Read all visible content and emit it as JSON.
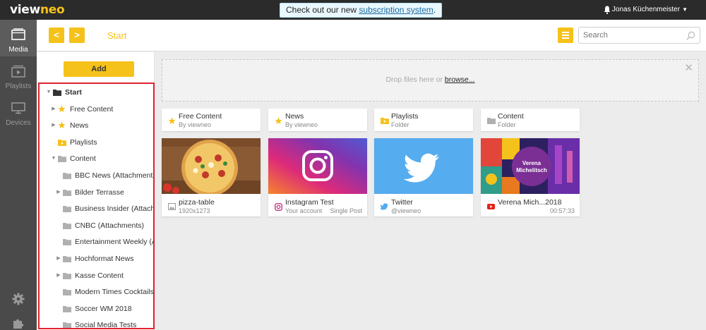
{
  "app": {
    "logo_main": "view",
    "logo_accent": "neo",
    "announcement_prefix": "Check out our new ",
    "announcement_link": "subscription system",
    "announcement_suffix": ".",
    "user_name": "Jonas Küchenmeister"
  },
  "colors": {
    "accent": "#f5c21b",
    "highlight": "#e0232f",
    "nav_bg": "#4a4a4a",
    "topbar_bg": "#2b2b2b"
  },
  "leftnav": [
    {
      "label": "Media",
      "icon": "media-icon",
      "active": true
    },
    {
      "label": "Playlists",
      "icon": "playlist-icon",
      "active": false
    },
    {
      "label": "Devices",
      "icon": "devices-icon",
      "active": false
    }
  ],
  "header": {
    "breadcrumb": "Start",
    "search_placeholder": "Search"
  },
  "sidebar": {
    "add_label": "Add",
    "tree": [
      {
        "label": "Start",
        "icon": "folder-dark-icon",
        "level": 0,
        "expander": "expanded"
      },
      {
        "label": "Free Content",
        "icon": "star-icon",
        "level": 1,
        "expander": "collapsed"
      },
      {
        "label": "News",
        "icon": "star-icon",
        "level": 1,
        "expander": "collapsed"
      },
      {
        "label": "Playlists",
        "icon": "playlist-folder-icon",
        "level": 1,
        "expander": "none"
      },
      {
        "label": "Content",
        "icon": "folder-icon",
        "level": 1,
        "expander": "expanded"
      },
      {
        "label": "BBC News (Attachments)",
        "icon": "folder-icon",
        "level": 2,
        "expander": "none"
      },
      {
        "label": "Bilder Terrasse",
        "icon": "folder-icon",
        "level": 2,
        "expander": "collapsed"
      },
      {
        "label": "Business Insider (Attachments)",
        "icon": "folder-icon",
        "level": 2,
        "expander": "none"
      },
      {
        "label": "CNBC (Attachments)",
        "icon": "folder-icon",
        "level": 2,
        "expander": "none"
      },
      {
        "label": "Entertainment Weekly (Attachments)",
        "icon": "folder-icon",
        "level": 2,
        "expander": "none"
      },
      {
        "label": "Hochformat News",
        "icon": "folder-icon",
        "level": 2,
        "expander": "collapsed"
      },
      {
        "label": "Kasse Content",
        "icon": "folder-icon",
        "level": 2,
        "expander": "collapsed"
      },
      {
        "label": "Modern Times Cocktails (Attachments)",
        "icon": "folder-icon",
        "level": 2,
        "expander": "none"
      },
      {
        "label": "Soccer WM 2018",
        "icon": "folder-icon",
        "level": 2,
        "expander": "none"
      },
      {
        "label": "Social Media Tests",
        "icon": "folder-icon",
        "level": 2,
        "expander": "none"
      }
    ]
  },
  "dropzone": {
    "text": "Drop files here or",
    "link": "browse..."
  },
  "folders": [
    {
      "title": "Free Content",
      "subtitle": "By viewneo",
      "icon": "star-icon"
    },
    {
      "title": "News",
      "subtitle": "By viewneo",
      "icon": "star-icon"
    },
    {
      "title": "Playlists",
      "subtitle": "Folder",
      "icon": "playlist-folder-icon"
    },
    {
      "title": "Content",
      "subtitle": "Folder",
      "icon": "folder-icon"
    }
  ],
  "media": [
    {
      "title": "pizza-table",
      "subtitle": "1920x1273",
      "meta": "",
      "icon": "image-icon"
    },
    {
      "title": "Instagram Test",
      "subtitle": "Your account",
      "meta": "Single Post",
      "icon": "instagram-icon"
    },
    {
      "title": "Twitter",
      "subtitle": "@viewneo",
      "meta": "",
      "icon": "twitter-icon"
    },
    {
      "title": "Verena Mich...2018",
      "subtitle": "",
      "meta": "00:57:33",
      "icon": "youtube-icon",
      "thumb_caption_1": "Verena",
      "thumb_caption_2": "Michelitsch"
    }
  ]
}
